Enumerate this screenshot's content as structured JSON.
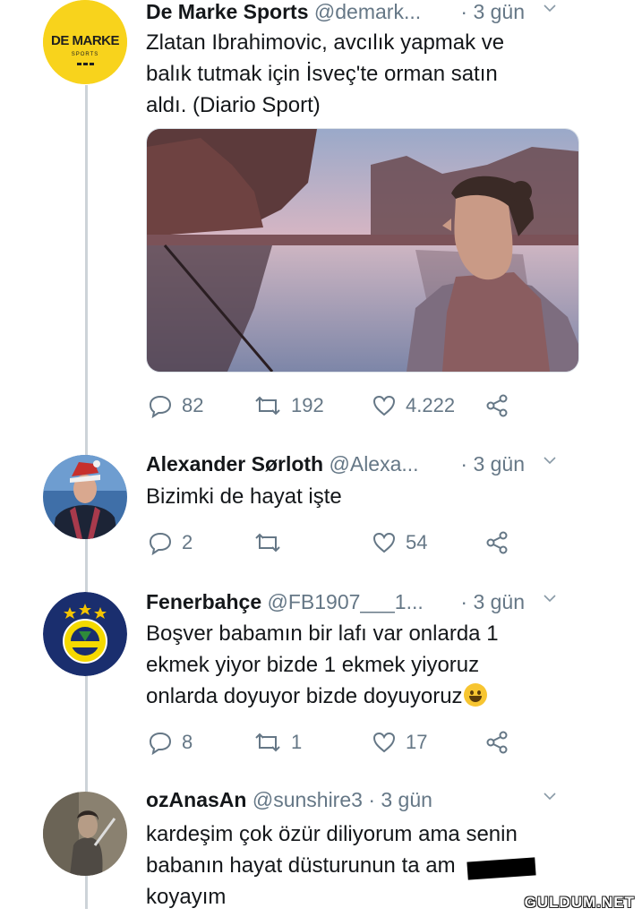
{
  "tweets": [
    {
      "name": "De Marke Sports",
      "handle": "@demark...",
      "time": "· 3 gün",
      "text_lines": [
        "Zlatan Ibrahimovic, avcılık yapmak ve",
        "balık tutmak için İsveç'te orman satın",
        "aldı. (Diario Sport)"
      ],
      "avatar_logo": {
        "line1": "DE MARKE",
        "line2": "SPORTS"
      },
      "counts": {
        "replies": "82",
        "retweets": "192",
        "likes": "4.222"
      }
    },
    {
      "name": "Alexander Sørloth",
      "handle": "@Alexa...",
      "time": "· 3 gün",
      "text_lines": [
        "Bizimki de hayat işte"
      ],
      "counts": {
        "replies": "2",
        "retweets": "",
        "likes": "54"
      }
    },
    {
      "name": "Fenerbahçe",
      "handle": "@FB1907___1...",
      "time": "· 3 gün",
      "text_lines": [
        "Boşver babamın bir lafı var onlarda 1",
        "ekmek yiyor bizde 1 ekmek yiyoruz",
        "onlarda doyuyor bizde doyuyoruz"
      ],
      "counts": {
        "replies": "8",
        "retweets": "1",
        "likes": "17"
      }
    },
    {
      "name": "ozAnasAn",
      "handle": "@sunshire3",
      "time": "· 3 gün",
      "text_lines": [
        "kardeşim çok özür diliyorum ama senin",
        "babanın hayat düsturunun ta am",
        "koyayım"
      ]
    }
  ],
  "watermark": "GULDUM.NET",
  "colors": {
    "text": "#14171a",
    "muted": "#657786",
    "thread": "#cdd3d8",
    "logo_bg": "#f8d31c"
  },
  "icons": [
    "reply-icon",
    "retweet-icon",
    "like-icon",
    "share-icon",
    "chevron-down-icon"
  ]
}
